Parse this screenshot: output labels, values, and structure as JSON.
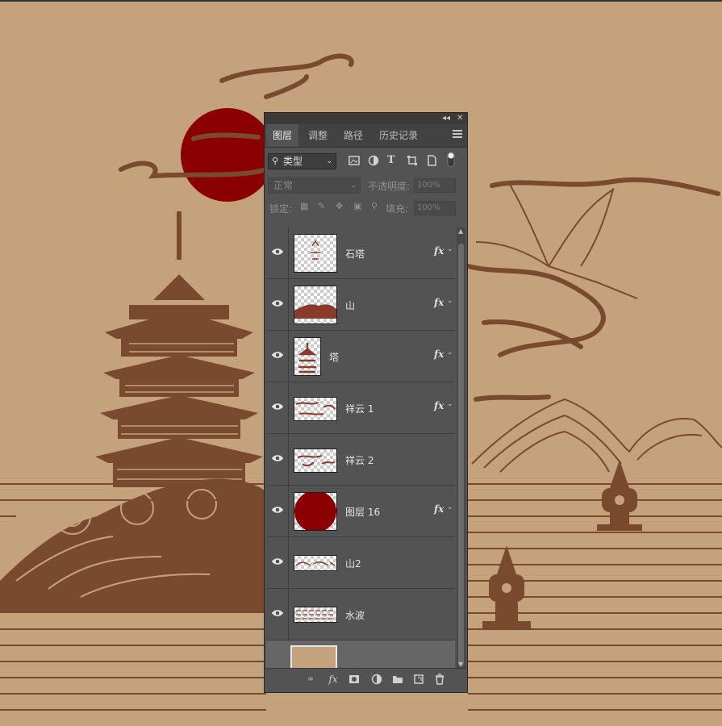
{
  "panel": {
    "collapse_icon": "double-chevron-icon",
    "close_icon": "close-icon",
    "tabs": [
      {
        "label": "图层",
        "active": true
      },
      {
        "label": "调整",
        "active": false
      },
      {
        "label": "路径",
        "active": false
      },
      {
        "label": "历史记录",
        "active": false
      }
    ],
    "filter": {
      "label": "类型"
    },
    "blend_mode": "正常",
    "opacity_label": "不透明度:",
    "opacity_value": "100%",
    "lock_label": "锁定:",
    "fill_label": "填充:",
    "fill_value": "100%",
    "layers": [
      {
        "name": "石塔",
        "fx": true,
        "thumb": "pagoda-small"
      },
      {
        "name": "山",
        "fx": true,
        "thumb": "mountain"
      },
      {
        "name": "塔",
        "fx": true,
        "thumb": "tower"
      },
      {
        "name": "祥云 1",
        "fx": true,
        "thumb": "cloud"
      },
      {
        "name": "祥云 2",
        "fx": false,
        "thumb": "cloud2"
      },
      {
        "name": "图层 16",
        "fx": true,
        "thumb": "red-sun"
      },
      {
        "name": "山2",
        "fx": false,
        "thumb": "hills"
      },
      {
        "name": "水波",
        "fx": false,
        "thumb": "waves"
      }
    ],
    "fx_label": "fx"
  },
  "colors": {
    "background": "#c4a27b",
    "line_art": "#7a4a2e",
    "sun": "#8b0000",
    "panel": "#535353"
  }
}
